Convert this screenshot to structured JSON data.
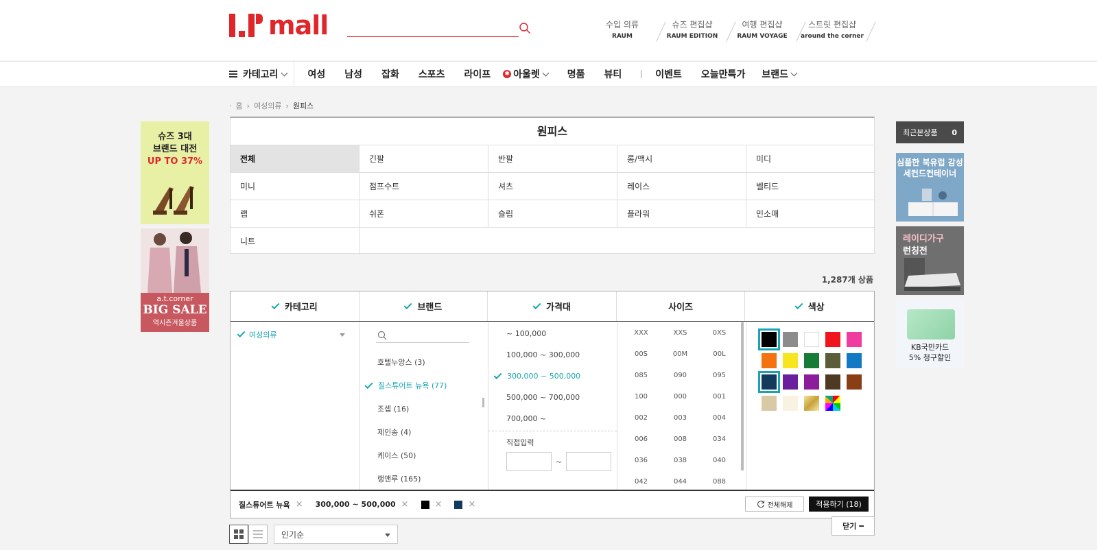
{
  "brand": {
    "logo_text": "mall",
    "color": "#e0262b"
  },
  "search": {
    "placeholder": ""
  },
  "shops": [
    {
      "kr": "수입 의류",
      "en": "RAUM"
    },
    {
      "kr": "슈즈 편집샵",
      "en": "RAUM EDITION"
    },
    {
      "kr": "여행 편집샵",
      "en": "RAUM VOYAGE"
    },
    {
      "kr": "스트릿 편집샵",
      "en": "around the corner"
    }
  ],
  "nav": {
    "category": "카테고리",
    "items": [
      "여성",
      "남성",
      "잡화",
      "스포츠",
      "라이프"
    ],
    "outlet": "아울렛",
    "items2": [
      "명품",
      "뷰티"
    ],
    "event": "이벤트",
    "today": "오늘만특가",
    "brand": "브랜드"
  },
  "breadcrumb": {
    "home": "홈",
    "level1": "여성의류",
    "current": "원피스"
  },
  "left_ads": {
    "ad1_line1": "슈즈 3대",
    "ad1_line2": "브랜드 대전",
    "ad1_line3": "UP TO 37%",
    "ad2_line1": "a.t.corner",
    "ad2_line2": "BIG SALE",
    "ad2_line3": "역시즌겨울상품"
  },
  "recent": {
    "label": "최근본상품",
    "count": "0"
  },
  "right_ads": {
    "ar1_line1": "심플한 북유럽 감성",
    "ar1_line2": "세컨드컨테이너",
    "ar2_line1": "레이디가구",
    "ar2_line2": "런칭전",
    "ar3_line1": "KB국민카드",
    "ar3_line2": "5% 청구할인"
  },
  "category": {
    "title": "원피스",
    "cells": [
      "전체",
      "긴팔",
      "반팔",
      "롱/맥시",
      "미디",
      "미니",
      "점프수트",
      "셔츠",
      "레이스",
      "벨티드",
      "랩",
      "쉬폰",
      "슬립",
      "플라워",
      "민소매",
      "니트"
    ]
  },
  "product_count": "1,287개 상품",
  "filter": {
    "headers": {
      "category": "카테고리",
      "brand": "브랜드",
      "price": "가격대",
      "size": "사이즈",
      "color": "색상"
    },
    "category_selected": "여성의류",
    "brand_items": [
      {
        "label": "호텔누앙스 (3)",
        "selected": false
      },
      {
        "label": "질스튜어트 뉴욕 (77)",
        "selected": true
      },
      {
        "label": "조셉 (16)",
        "selected": false
      },
      {
        "label": "제인송 (4)",
        "selected": false
      },
      {
        "label": "케이스 (50)",
        "selected": false
      },
      {
        "label": "랭앤루 (165)",
        "selected": false
      }
    ],
    "price_items": [
      "~ 100,000",
      "100,000 ~ 300,000",
      "300,000 ~ 500,000",
      "500,000 ~ 700,000",
      "700,000 ~"
    ],
    "price_selected": "300,000 ~ 500,000",
    "direct_label": "직접입력",
    "direct_tilde": "~",
    "sizes": [
      "XXX",
      "XXS",
      "0XS",
      "00S",
      "00M",
      "00L",
      "085",
      "090",
      "095",
      "100",
      "000",
      "001",
      "002",
      "003",
      "004",
      "006",
      "008",
      "034",
      "036",
      "038",
      "040",
      "042",
      "044",
      "088"
    ],
    "colors": [
      {
        "hex": "#000000",
        "on": true
      },
      {
        "hex": "#8c8c8c",
        "on": false
      },
      {
        "hex": "#ffffff",
        "on": false
      },
      {
        "hex": "#f0141e",
        "on": false
      },
      {
        "hex": "#f03ca0",
        "on": false
      },
      {
        "hex": "#f4720f",
        "on": false
      },
      {
        "hex": "#f7e51e",
        "on": false
      },
      {
        "hex": "#167b34",
        "on": false
      },
      {
        "hex": "#5b5c3a",
        "on": false
      },
      {
        "hex": "#1479c4",
        "on": false
      },
      {
        "hex": "#123a5c",
        "on": true
      },
      {
        "hex": "#6a1f9c",
        "on": false
      },
      {
        "hex": "#8c1c9c",
        "on": false
      },
      {
        "hex": "#4e3a22",
        "on": false
      },
      {
        "hex": "#8a3e16",
        "on": false
      },
      {
        "hex": "#d9c9a4",
        "on": false
      },
      {
        "hex": "#f9f1e2",
        "on": false
      },
      {
        "hex": "gold",
        "on": false
      },
      {
        "hex": "multi",
        "on": false
      }
    ],
    "selected_tags": {
      "brand": "질스튜어트 뉴욕",
      "price": "300,000 ~ 500,000"
    },
    "tag_x": "×",
    "reset_label": "전체해제",
    "apply_label": "적용하기 (18)"
  },
  "close_label": "닫기 ━",
  "sort": {
    "selected": "인기순"
  },
  "accent": "#17a5b4"
}
